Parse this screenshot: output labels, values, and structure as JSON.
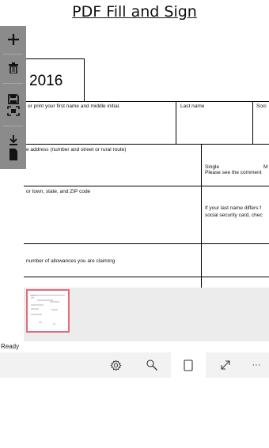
{
  "app": {
    "title": "PDF Fill and Sign"
  },
  "toolbar": {
    "add": "add-icon",
    "delete": "trash-icon",
    "save": "save-icon",
    "scan": "scan-icon",
    "download": "download-icon"
  },
  "document": {
    "year": "2016",
    "first_name_label": "or print your first name and middle initial.",
    "last_name_label": "Last name",
    "social_label": "Soci",
    "address_label": "e address (number and street or rural route)",
    "single_label": "Single",
    "married_label": "M",
    "see_comment": "Please see the comment",
    "city_label": "or town, state, and ZIP code",
    "last_name_differs": "If your last name differs f",
    "social_card": "social security card, chec",
    "allowances_label": "number of allowances you are claiming"
  },
  "thumbnails": {
    "count": 1,
    "selected_index": 0
  },
  "status": {
    "text": "Ready"
  },
  "commandbar": {
    "settings": "settings-icon",
    "search": "search-icon",
    "page": "page-icon",
    "fullscreen": "fullscreen-icon",
    "more": "···"
  }
}
